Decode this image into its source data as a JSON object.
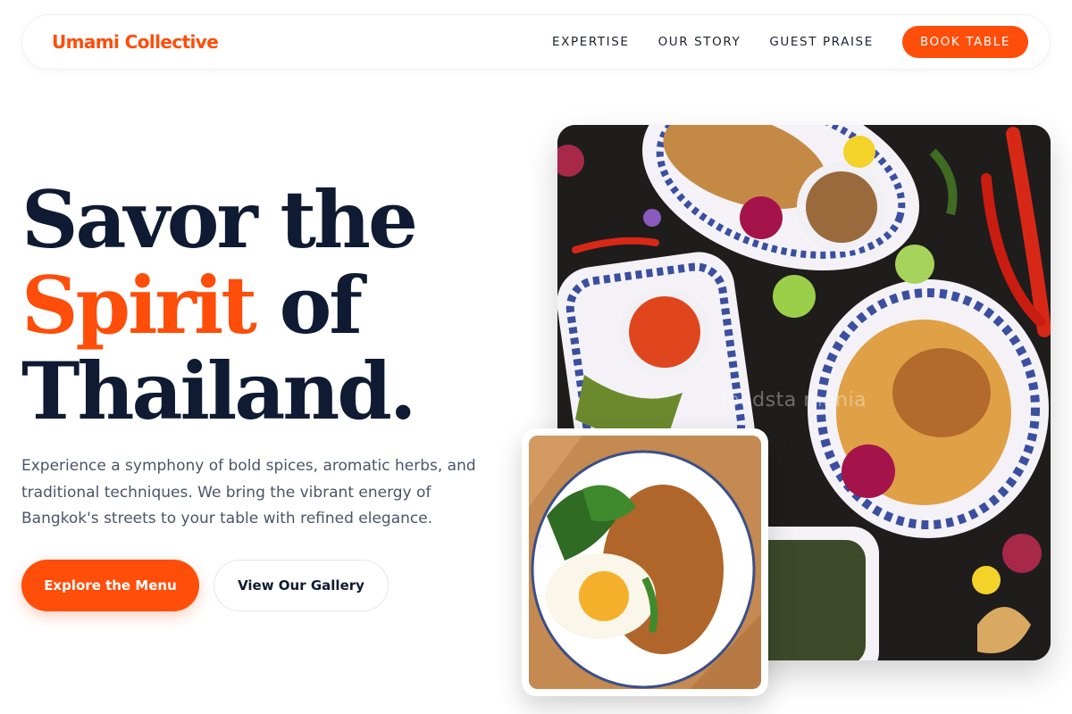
{
  "brand": {
    "name": "Umami Collective"
  },
  "nav": {
    "links": [
      "EXPERTISE",
      "OUR STORY",
      "GUEST PRAISE"
    ],
    "cta": "BOOK TABLE"
  },
  "hero": {
    "headline_line1": "Savor the",
    "headline_accent": "Spirit",
    "headline_line2_rest": " of",
    "headline_line3": "Thailand.",
    "lede": "Experience a symphony of bold spices, aromatic herbs, and traditional techniques. We bring the vibrant energy of Bangkok's streets to your table with refined elegance.",
    "primary_cta": "Explore the Menu",
    "secondary_cta": "View Our Gallery"
  },
  "images": {
    "main_watermark": "foodsta  mania",
    "main_photo": "thai-food-spread-photo",
    "inset_photo": "basil-stir-fry-egg-photo"
  },
  "colors": {
    "accent": "#ff4d0a",
    "heading": "#0f1b33",
    "body_text": "#4a5568"
  }
}
